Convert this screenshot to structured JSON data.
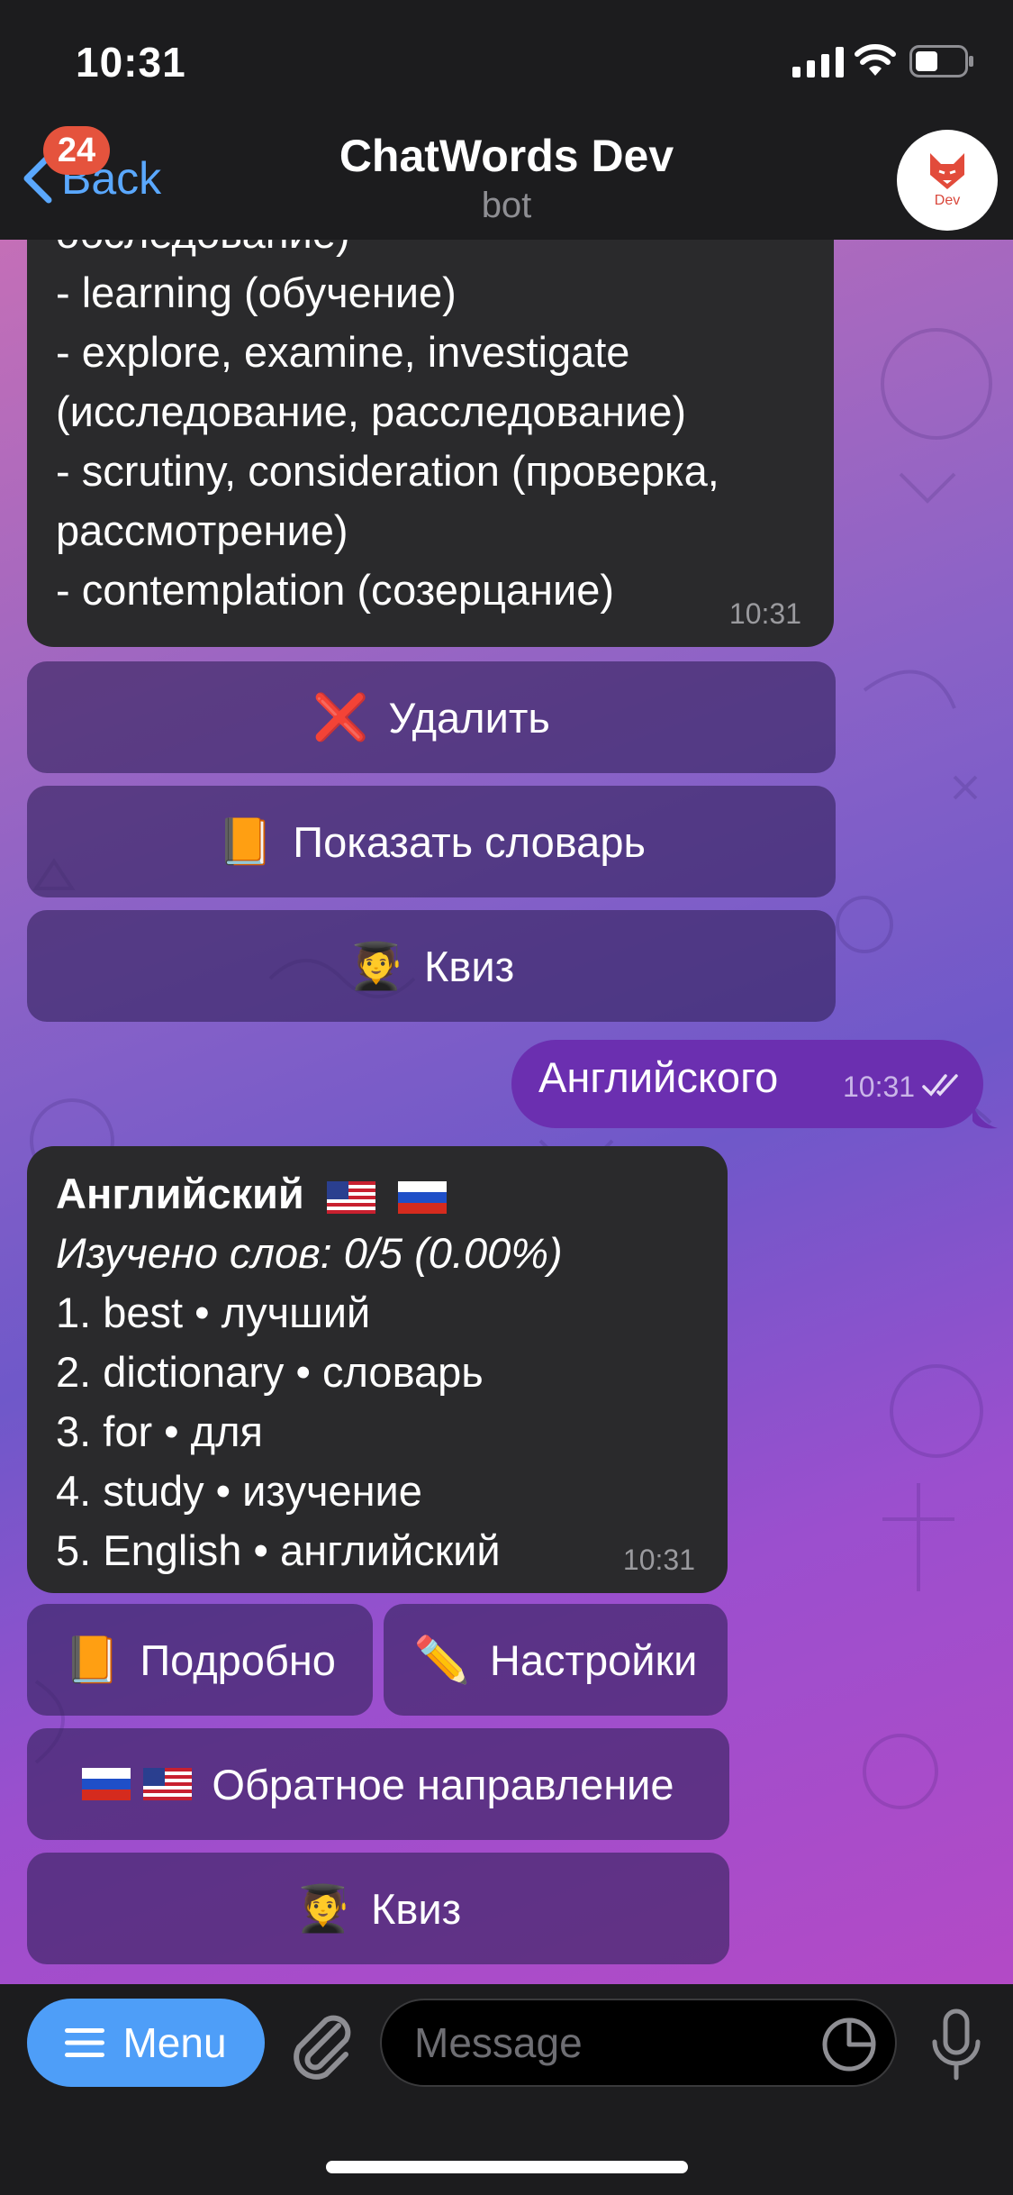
{
  "status_bar": {
    "time": "10:31"
  },
  "header": {
    "back_label": "Back",
    "unread_count": "24",
    "title": "ChatWords Dev",
    "subtitle": "bot",
    "avatar_label": "Dev"
  },
  "messages": {
    "first": {
      "lines": [
        "обследование)",
        "- learning (обучение)",
        "- explore, examine, investigate",
        "(исследование, расследование)",
        "- scrutiny, consideration (проверка,",
        "рассмотрение)",
        "- contemplation (созерцание)"
      ],
      "time": "10:31",
      "buttons": [
        {
          "emoji": "❌",
          "label": "Удалить"
        },
        {
          "emoji": "📙",
          "label": "Показать словарь"
        },
        {
          "emoji": "🧑‍🎓",
          "label": "Квиз"
        }
      ]
    },
    "outgoing": {
      "text": "Английского",
      "time": "10:31"
    },
    "second": {
      "title": "Английский",
      "progress": "Изучено слов: 0/5 (0.00%)",
      "items": [
        "1. best • лучший",
        "2. dictionary • словарь",
        "3. for • для",
        "4. study • изучение",
        "5. English • английский"
      ],
      "time": "10:31",
      "buttons": {
        "details": {
          "emoji": "📙",
          "label": "Подробно"
        },
        "settings": {
          "emoji": "✏️",
          "label": "Настройки"
        },
        "reverse": {
          "label": "Обратное направление"
        },
        "quiz": {
          "emoji": "🧑‍🎓",
          "label": "Квиз"
        }
      }
    }
  },
  "input_bar": {
    "menu_label": "Menu",
    "message_placeholder": "Message"
  },
  "colors": {
    "accent": "#4e9ef8",
    "badge": "#e5533d",
    "outgoing_bubble": "#6b2fb0",
    "incoming_bubble": "#2a2a2c"
  }
}
